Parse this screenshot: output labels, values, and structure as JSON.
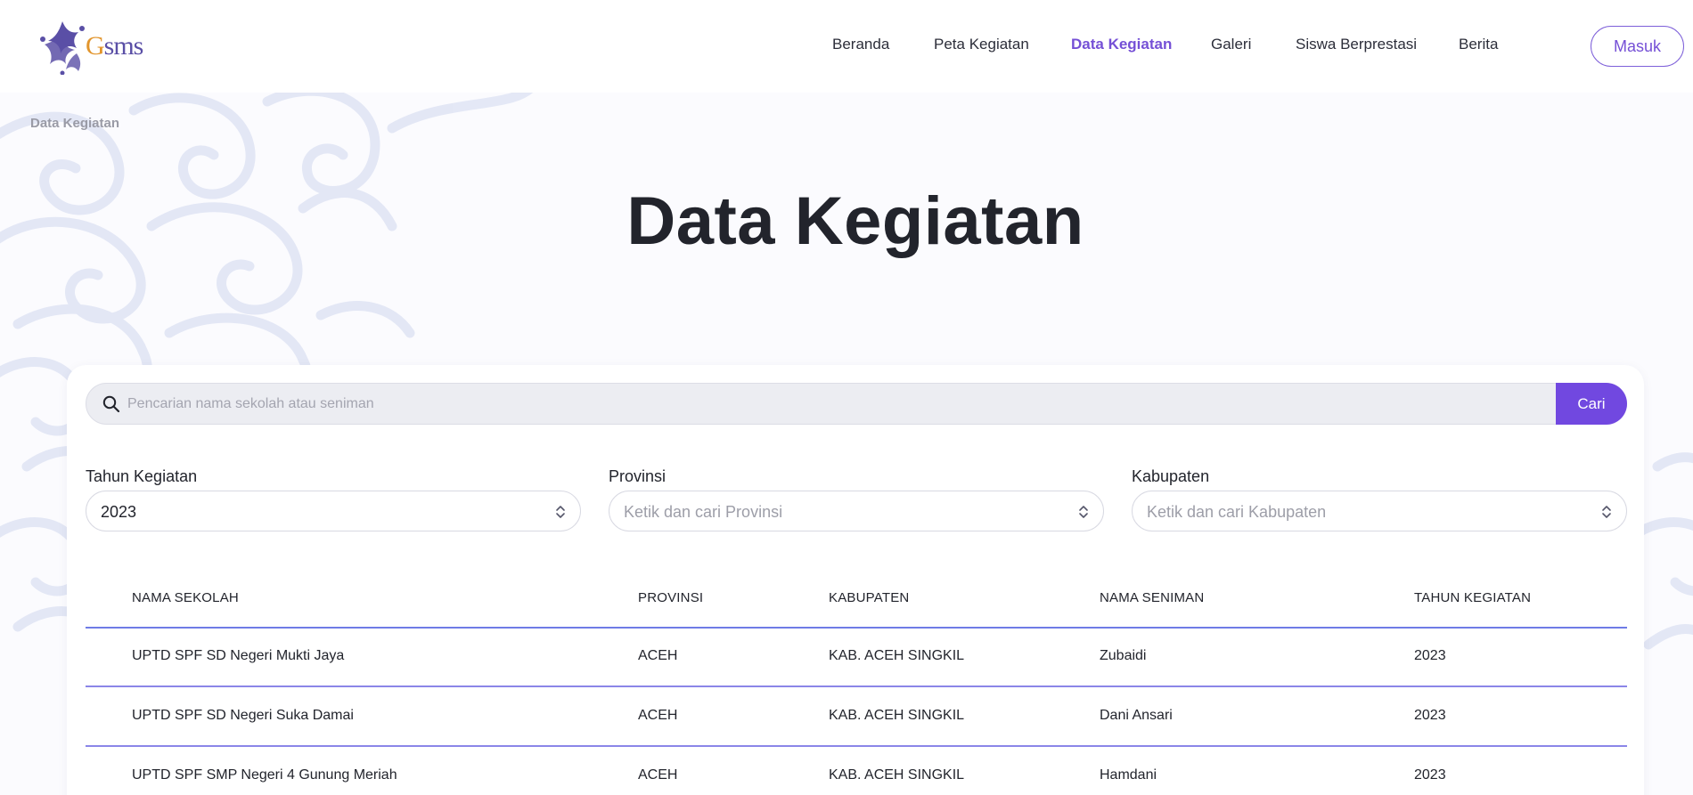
{
  "brand": {
    "logo_text_g": "G",
    "logo_text_rest": "sms"
  },
  "nav": {
    "items": [
      {
        "label": "Beranda",
        "active": false
      },
      {
        "label": "Peta Kegiatan",
        "active": false
      },
      {
        "label": "Data Kegiatan",
        "active": true
      },
      {
        "label": "Galeri",
        "active": false
      },
      {
        "label": "Siswa Berprestasi",
        "active": false
      },
      {
        "label": "Berita",
        "active": false
      }
    ],
    "login_label": "Masuk"
  },
  "breadcrumb": "Data Kegiatan",
  "page_title": "Data Kegiatan",
  "search": {
    "placeholder": "Pencarian nama sekolah atau seniman",
    "value": "",
    "button_label": "Cari"
  },
  "filters": [
    {
      "label": "Tahun Kegiatan",
      "value": "2023",
      "placeholder": ""
    },
    {
      "label": "Provinsi",
      "value": "",
      "placeholder": "Ketik dan cari Provinsi"
    },
    {
      "label": "Kabupaten",
      "value": "",
      "placeholder": "Ketik dan cari Kabupaten"
    }
  ],
  "table": {
    "columns": [
      "NAMA SEKOLAH",
      "PROVINSI",
      "KABUPATEN",
      "NAMA SENIMAN",
      "TAHUN KEGIATAN"
    ],
    "rows": [
      [
        "UPTD SPF SD Negeri Mukti Jaya",
        "ACEH",
        "KAB. ACEH SINGKIL",
        "Zubaidi",
        "2023"
      ],
      [
        "UPTD SPF SD Negeri Suka Damai",
        "ACEH",
        "KAB. ACEH SINGKIL",
        "Dani Ansari",
        "2023"
      ],
      [
        "UPTD SPF SMP Negeri 4 Gunung Meriah",
        "ACEH",
        "KAB. ACEH SINGKIL",
        "Hamdani",
        "2023"
      ]
    ]
  },
  "colors": {
    "accent": "#7148e0",
    "active_nav": "#7550d6",
    "row_divider": "#8b86e8",
    "logo_purple": "#5a4fa6",
    "logo_orange": "#e2952c"
  },
  "icons": [
    "logo-star-icon",
    "search-icon",
    "select-updown-icon"
  ]
}
